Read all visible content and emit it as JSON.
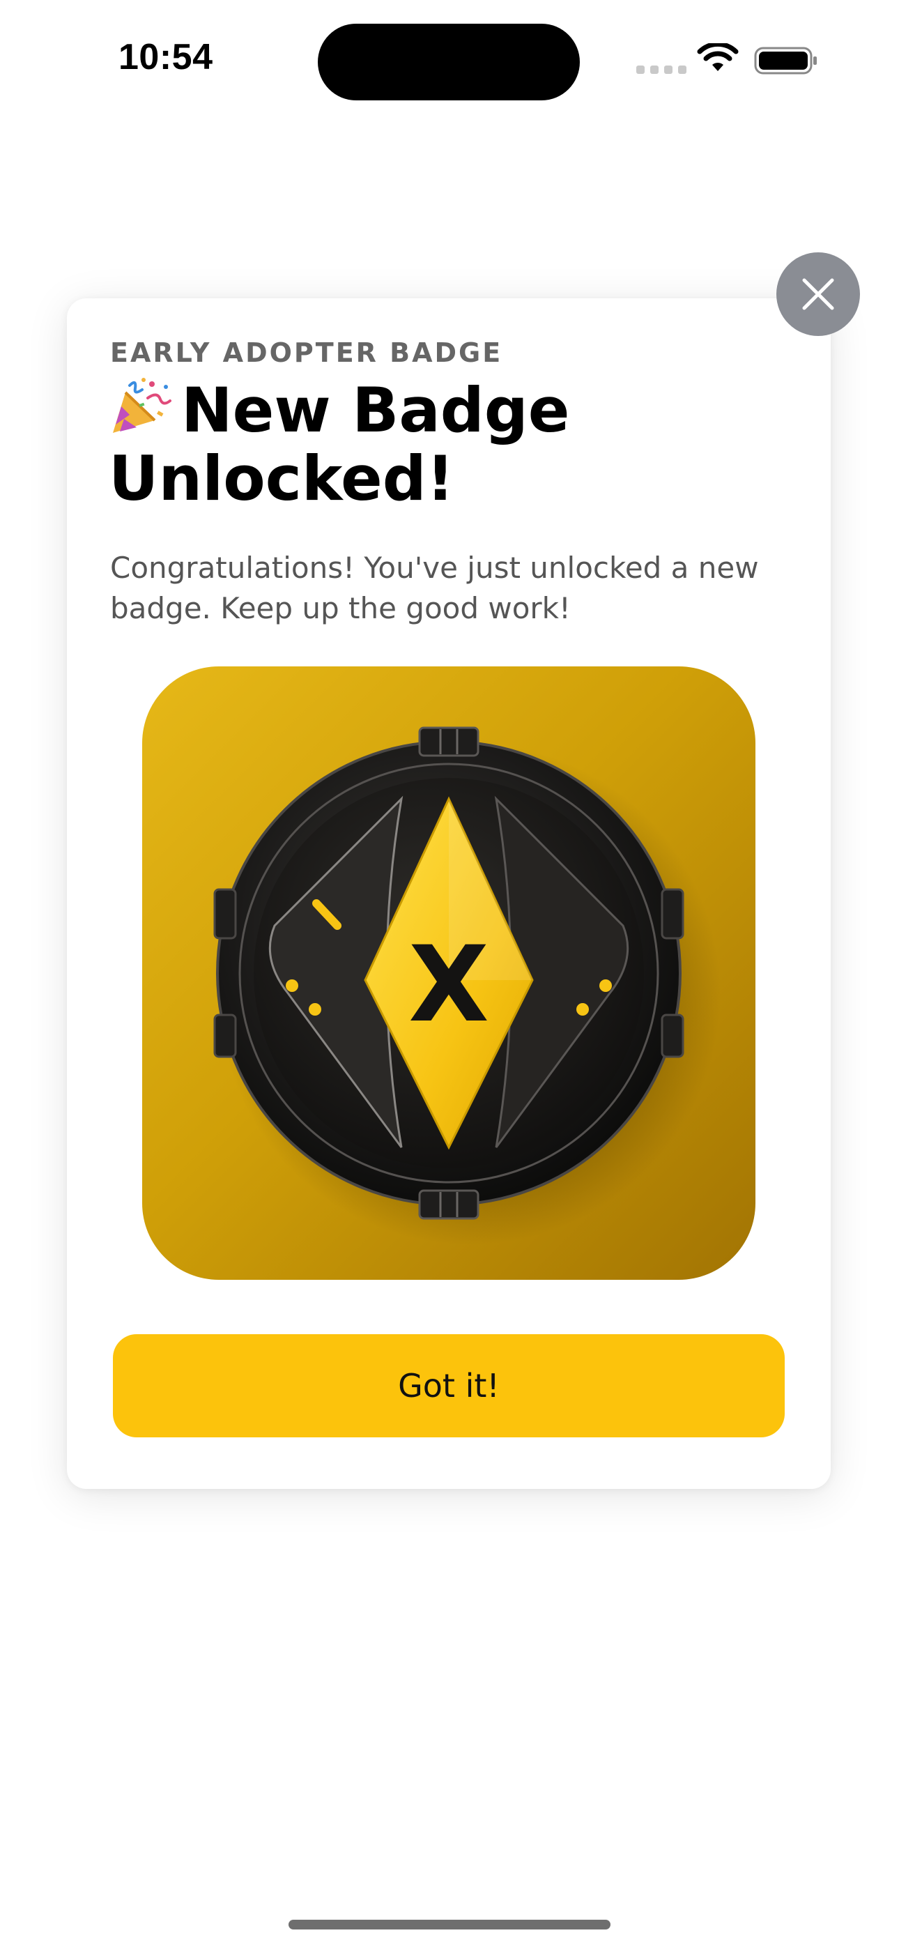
{
  "status_bar": {
    "time": "10:54",
    "wifi_icon": "wifi-icon",
    "battery_icon": "battery-icon"
  },
  "modal": {
    "eyebrow": "EARLY ADOPTER BADGE",
    "title_emoji_icon": "party-popper-icon",
    "title": "New Badge Unlocked!",
    "message": "Congratulations! You've just unlocked a new badge. Keep up the good work!",
    "badge_letter": "X",
    "button_label": "Got it!",
    "close_icon": "close-icon"
  },
  "colors": {
    "accent": "#fcc30c",
    "close_button": "#8a8d94",
    "badge_background": "#d4a40c"
  }
}
